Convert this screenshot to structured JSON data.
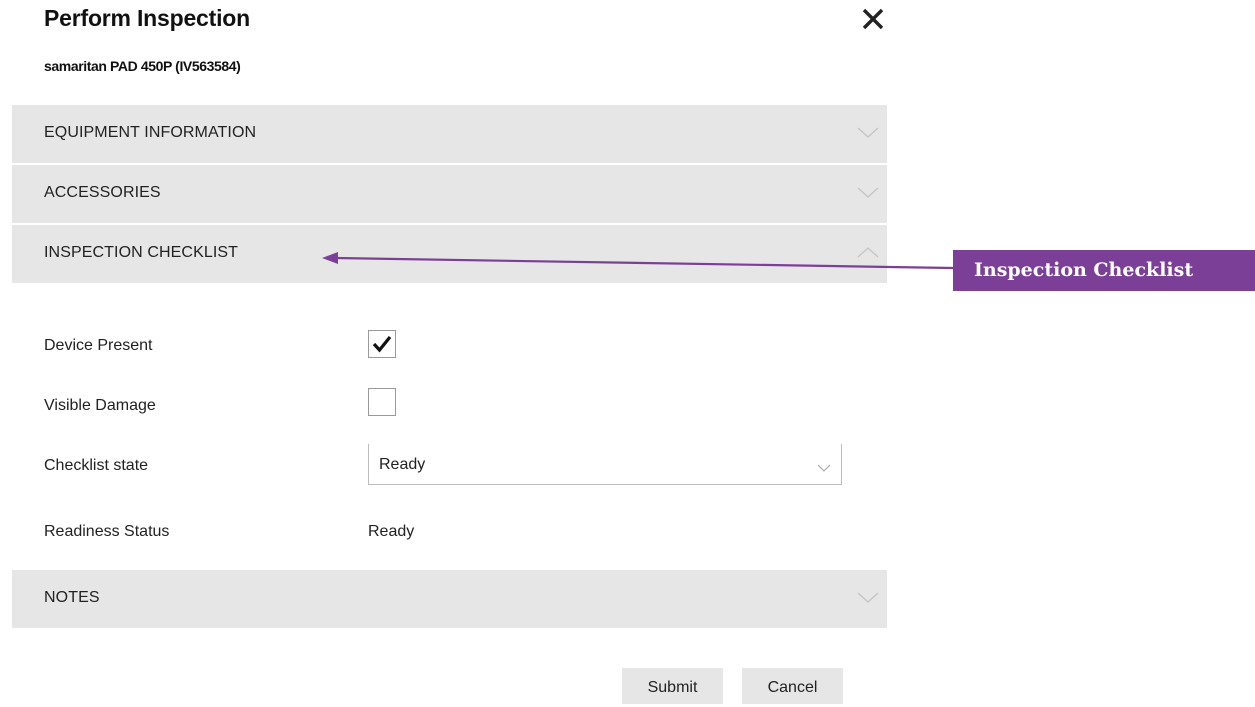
{
  "dialog": {
    "title": "Perform Inspection",
    "subtitle": "samaritan PAD 450P (IV563584)",
    "close_icon": "close-icon"
  },
  "sections": {
    "equipment_information": {
      "label": "EQUIPMENT INFORMATION",
      "state": "collapsed"
    },
    "accessories": {
      "label": "ACCESSORIES",
      "state": "collapsed"
    },
    "inspection_checklist": {
      "label": "INSPECTION CHECKLIST",
      "state": "expanded"
    },
    "notes": {
      "label": "NOTES",
      "state": "collapsed"
    }
  },
  "checklist": {
    "device_present": {
      "label": "Device Present",
      "checked": true
    },
    "visible_damage": {
      "label": "Visible Damage",
      "checked": false
    },
    "checklist_state": {
      "label": "Checklist state",
      "value": "Ready"
    },
    "readiness_status": {
      "label": "Readiness Status",
      "value": "Ready"
    }
  },
  "buttons": {
    "submit": "Submit",
    "cancel": "Cancel"
  },
  "annotation": {
    "callout_text": "Inspection Checklist",
    "color": "#7b3f98"
  },
  "colors": {
    "section_bg": "#e6e6e6",
    "button_bg": "#e6e6e6",
    "callout": "#7b3f98"
  }
}
